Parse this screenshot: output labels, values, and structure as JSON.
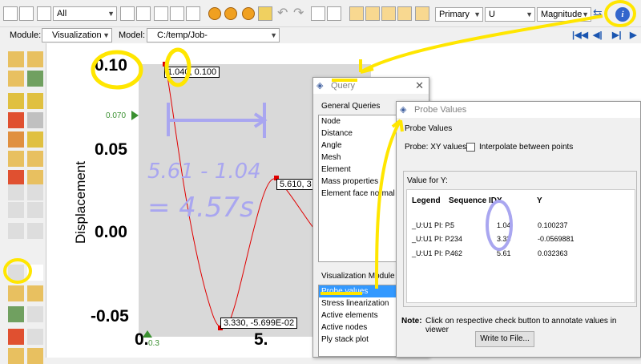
{
  "toolbar": {
    "filter_value": "All",
    "primary_value": "Primary",
    "component_value": "U",
    "invariant_value": "Magnitude"
  },
  "modulebar": {
    "module_label": "Module:",
    "module_value": "Visualization",
    "model_label": "Model:",
    "model_value": "C:/temp/Job-SDOFtransient.odb"
  },
  "plot": {
    "y_axis_label": "Displacement",
    "y_ticks": [
      "0.10",
      "0.05",
      "0.00",
      "-0.05"
    ],
    "x_ticks": [
      "0.",
      "5."
    ],
    "ref_marker_label": "0.070",
    "x_marker_label": "0.3",
    "annotations": [
      "1.040, 0.100",
      "5.610, 3",
      "3.330, -5.699E-02"
    ]
  },
  "chart_data": {
    "type": "line",
    "ylabel": "Displacement",
    "y_ticks": [
      0.1,
      0.05,
      0.0,
      -0.05
    ],
    "x_ticks": [
      0,
      5
    ],
    "annotated_points": [
      {
        "x": 1.04,
        "y": 0.100237
      },
      {
        "x": 3.33,
        "y": -0.0569881
      },
      {
        "x": 5.61,
        "y": 0.032363
      }
    ]
  },
  "query": {
    "title": "Query",
    "general_label": "General Queries",
    "general_items": [
      "Node",
      "Distance",
      "Angle",
      "Mesh",
      "Element",
      "Mass properties",
      "Element face normal"
    ],
    "vis_label": "Visualization Module Q",
    "vis_items": [
      "Probe values",
      "Stress linearization",
      "Active elements",
      "Active nodes",
      "Ply stack plot"
    ],
    "selected_item": "Probe values"
  },
  "probe": {
    "title": "Probe Values",
    "section_label": "Probe Values",
    "probe_label": "Probe: XY values",
    "interpolate_label": "Interpolate between points",
    "value_for_label": "Value for Y:",
    "columns": [
      "Legend",
      "Sequence ID",
      "X",
      "Y"
    ],
    "rows": [
      {
        "legend": "_U:U1 PI: P.",
        "seq": "5",
        "x": "1.04",
        "y": "0.100237"
      },
      {
        "legend": "_U:U1 PI: P.",
        "seq": "234",
        "x": "3.33",
        "y": "-0.0569881"
      },
      {
        "legend": "_U:U1 PI: P.",
        "seq": "462",
        "x": "5.61",
        "y": "0.032363"
      }
    ],
    "note_label": "Note:",
    "note_text": "Click on respective check button to annotate values in viewer",
    "write_button": "Write to File..."
  },
  "handwriting": {
    "line1": "5.61 - 1.04",
    "line2": "= 4.57s"
  },
  "colors": {
    "curve": "#e00000",
    "highlight": "#ffe600",
    "handwriting": "#a9a6f0",
    "selection": "#3399ff"
  }
}
